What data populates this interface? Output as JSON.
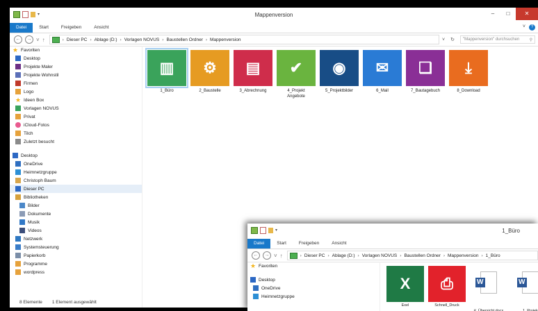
{
  "main": {
    "title": "Mappenversion",
    "ribbon_tabs": [
      "Datei",
      "Start",
      "Freigeben",
      "Ansicht"
    ],
    "window_buttons": [
      "–",
      "□",
      "✕"
    ],
    "address": {
      "back": "←",
      "forward": "→",
      "down": "˅",
      "up": "↑",
      "segments": [
        "Dieser PC",
        "Ablage (D:)",
        "Vorlagen NOVUS",
        "Baustellen Ordner",
        "Mappenversion"
      ],
      "separator": "›",
      "dropdown": "˅",
      "refresh": "↻"
    },
    "search": {
      "placeholder": "\"Mappenversion\" durchsuchen",
      "icon": "⚲"
    },
    "sidebar": [
      {
        "label": "Favoriten",
        "icon": "star-icon",
        "color": "#f3b51d"
      },
      {
        "label": "Desktop",
        "icon": "desktop-icon",
        "color": "#2c68c4"
      },
      {
        "label": "Projekte Maler",
        "icon": "folder-icon",
        "color": "#6c2f86"
      },
      {
        "label": "Projekte Wohnstil",
        "icon": "folder-icon",
        "color": "#5b6fb8"
      },
      {
        "label": "Firmen",
        "icon": "folder-icon",
        "color": "#c0392b"
      },
      {
        "label": "Logo",
        "icon": "folder-icon",
        "color": "#e6a23c"
      },
      {
        "label": "Ideen Box",
        "icon": "star-icon",
        "color": "#f3b51d"
      },
      {
        "label": "Vorlagen NOVUS",
        "icon": "folder-icon",
        "color": "#3aa35b"
      },
      {
        "label": "Privat",
        "icon": "folder-icon",
        "color": "#e6a23c"
      },
      {
        "label": "iCloud-Fotos",
        "icon": "cloud-icon",
        "color": "#e95b8f"
      },
      {
        "label": "Tilch",
        "icon": "folder-icon",
        "color": "#e6a23c"
      },
      {
        "label": "Zuletzt besucht",
        "icon": "recent-icon",
        "color": "#8a8a8a"
      },
      {
        "label": "",
        "icon": "",
        "color": ""
      },
      {
        "label": "Desktop",
        "icon": "desktop-icon",
        "color": "#2c68c4"
      },
      {
        "label": "OneDrive",
        "icon": "onedrive-icon",
        "color": "#2f6fc1"
      },
      {
        "label": "Heimnetzgruppe",
        "icon": "homegroup-icon",
        "color": "#2d8fd5"
      },
      {
        "label": "Christoph Baum",
        "icon": "user-icon",
        "color": "#d9a64b"
      },
      {
        "label": "Dieser PC",
        "icon": "pc-icon",
        "color": "#2c68c4"
      },
      {
        "label": "Bibliotheken",
        "icon": "library-icon",
        "color": "#d6a13d"
      },
      {
        "label": "Bilder",
        "icon": "pictures-icon",
        "color": "#4b87c8"
      },
      {
        "label": "Dokumente",
        "icon": "documents-icon",
        "color": "#8b9bb5"
      },
      {
        "label": "Musik",
        "icon": "music-icon",
        "color": "#3178c6"
      },
      {
        "label": "Videos",
        "icon": "videos-icon",
        "color": "#3c4e7a"
      },
      {
        "label": "Netzwerk",
        "icon": "network-icon",
        "color": "#2e78c2"
      },
      {
        "label": "Systemsteuerung",
        "icon": "control-panel-icon",
        "color": "#3a7dc8"
      },
      {
        "label": "Papierkorb",
        "icon": "recycle-bin-icon",
        "color": "#7b8ea8"
      },
      {
        "label": "Programme",
        "icon": "folder-icon",
        "color": "#e6a23c"
      },
      {
        "label": "wordpress",
        "icon": "folder-icon",
        "color": "#e6a23c"
      }
    ],
    "tiles": [
      {
        "label": "1_Büro",
        "color": "#3aa35b",
        "icon": "binders-icon"
      },
      {
        "label": "2_Baustelle",
        "color": "#e69b22",
        "icon": "gear-binder-icon"
      },
      {
        "label": "3_Abrechnung",
        "color": "#cf2d4b",
        "icon": "invoice-icon"
      },
      {
        "label": "4_Projekt\nAngebote",
        "color": "#6ab43f",
        "icon": "cart-check-icon"
      },
      {
        "label": "5_Projektbilder",
        "color": "#184d86",
        "icon": "camera-icon"
      },
      {
        "label": "6_Mail",
        "color": "#2a7bd5",
        "icon": "mail-icon"
      },
      {
        "label": "7_Bautagebuch",
        "color": "#8a2f96",
        "icon": "book-icon"
      },
      {
        "label": "8_Download",
        "color": "#e96c1f",
        "icon": "download-icon"
      }
    ],
    "status": {
      "count": "8 Elemente",
      "selected": "1 Element ausgewählt"
    }
  },
  "second": {
    "title": "1_Büro",
    "ribbon_tabs": [
      "Datei",
      "Start",
      "Freigeben",
      "Ansicht"
    ],
    "address_segments": [
      "Dieser PC",
      "Ablage (D:)",
      "Vorlagen NOVUS",
      "Baustellen Ordner",
      "Mappenversion",
      "1_Büro"
    ],
    "sidebar": [
      {
        "label": "Favoriten",
        "icon": "star-icon",
        "color": "#f3b51d"
      },
      {
        "label": "",
        "icon": "",
        "color": ""
      },
      {
        "label": "Desktop",
        "icon": "desktop-icon",
        "color": "#2c68c4"
      },
      {
        "label": "OneDrive",
        "icon": "onedrive-icon",
        "color": "#2f6fc1"
      },
      {
        "label": "Heimnetzgruppe",
        "icon": "homegroup-icon",
        "color": "#2d8fd5"
      }
    ],
    "tiles": [
      {
        "label": "Exel",
        "color": "#1f7a45",
        "icon": "excel-icon"
      },
      {
        "label": "Schnell_Druck",
        "color": "#e2222b",
        "icon": "printer-icon"
      },
      {
        "label": "#_Übersicht.docx",
        "color": "#ffffff",
        "icon": "word-doc-icon"
      },
      {
        "label": "1_Projek",
        "color": "#ffffff",
        "icon": "word-doc-icon"
      }
    ]
  }
}
